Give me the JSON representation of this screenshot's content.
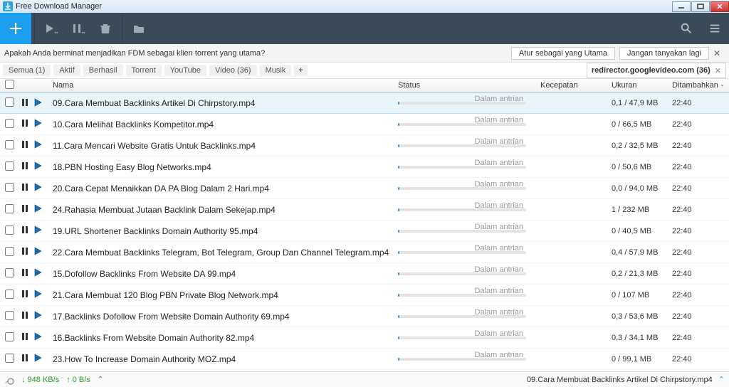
{
  "window": {
    "title": "Free Download Manager"
  },
  "toolbar": {},
  "prompt": {
    "text": "Apakah Anda berminat menjadikan FDM sebagai klien torrent yang utama?",
    "primary": "Atur sebagai yang Utama",
    "secondary": "Jangan tanyakan lagi"
  },
  "filters": {
    "items": [
      {
        "label": "Semua (1)"
      },
      {
        "label": "Aktif"
      },
      {
        "label": "Berhasil"
      },
      {
        "label": "Torrent"
      },
      {
        "label": "YouTube"
      },
      {
        "label": "Video (36)"
      },
      {
        "label": "Musik"
      }
    ],
    "group_badge": "redirector.googlevideo.com (36)"
  },
  "columns": {
    "name": "Nama",
    "status": "Status",
    "speed": "Kecepatan",
    "size": "Ukuran",
    "added": "Ditambahkan"
  },
  "status_text": "Dalam antrian",
  "rows": [
    {
      "name": "09.Cara Membuat Backlinks Artikel Di Chirpstory.mp4",
      "size": "0,1 / 47,9 MB",
      "added": "22:40",
      "selected": true
    },
    {
      "name": "10.Cara Melihat Backlinks Kompetitor.mp4",
      "size": "0 / 66,5 MB",
      "added": "22:40"
    },
    {
      "name": "11.Cara Mencari Website Gratis Untuk Backlinks.mp4",
      "size": "0,2 / 32,5 MB",
      "added": "22:40"
    },
    {
      "name": "18.PBN Hosting Easy Blog Networks.mp4",
      "size": "0 / 50,6 MB",
      "added": "22:40"
    },
    {
      "name": "20.Cara Cepat Menaikkan DA PA Blog Dalam 2 Hari.mp4",
      "size": "0,0 / 94,0 MB",
      "added": "22:40"
    },
    {
      "name": "24.Rahasia Membuat Jutaan Backlink Dalam Sekejap.mp4",
      "size": "1 / 232 MB",
      "added": "22:40"
    },
    {
      "name": "19.URL Shortener Backlinks Domain Authority 95.mp4",
      "size": "0 / 40,5 MB",
      "added": "22:40"
    },
    {
      "name": "22.Cara Membuat Backlinks Telegram, Bot Telegram, Group Dan Channel Telegram.mp4",
      "size": "0,4 / 57,9 MB",
      "added": "22:40"
    },
    {
      "name": "15.Dofollow Backlinks From Website DA 99.mp4",
      "size": "0,2 / 21,3 MB",
      "added": "22:40"
    },
    {
      "name": "21.Cara Membuat 120 Blog PBN Private Blog Network.mp4",
      "size": "0 / 107 MB",
      "added": "22:40"
    },
    {
      "name": "17.Backlinks Dofollow From Website Domain Authority 69.mp4",
      "size": "0,3 / 53,6 MB",
      "added": "22:40"
    },
    {
      "name": "16.Backlinks From Website Domain Authority 82.mp4",
      "size": "0,3 / 34,1 MB",
      "added": "22:40"
    },
    {
      "name": "23.How To Increase Domain Authority MOZ.mp4",
      "size": "0 / 99,1 MB",
      "added": "22:40"
    }
  ],
  "statusbar": {
    "down": "↓ 948 KB/s",
    "up": "↑ 0 B/s",
    "selected": "09.Cara Membuat Backlinks Artikel Di Chirpstory.mp4"
  }
}
